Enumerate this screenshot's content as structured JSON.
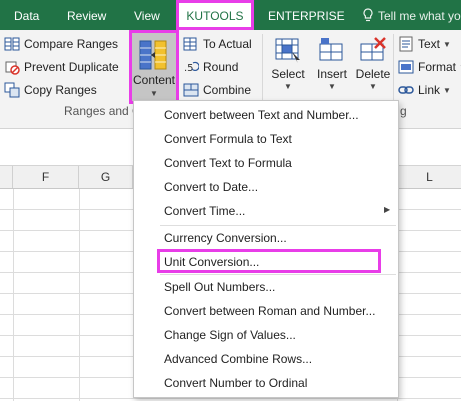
{
  "tabs": {
    "data": "Data",
    "review": "Review",
    "view": "View",
    "kutools": "KUTOOLS",
    "enterprise": "ENTERPRISE",
    "tell_me": "Tell me what yo"
  },
  "ribbon": {
    "compare_ranges": "Compare Ranges",
    "prevent_duplicate": "Prevent Duplicate",
    "copy_ranges": "Copy Ranges",
    "content": "Content",
    "to_actual": "To Actual",
    "round": "Round",
    "combine": "Combine",
    "select": "Select",
    "insert": "Insert",
    "delete": "Delete",
    "text": "Text",
    "format": "Format",
    "link": "Link",
    "group_label_left": "Ranges and C",
    "group_label_right": "g"
  },
  "grid": {
    "columns": [
      "F",
      "G",
      "L"
    ]
  },
  "menu": {
    "items": [
      "Convert between Text and Number...",
      "Convert Formula to Text",
      "Convert Text to Formula",
      "Convert to Date...",
      "Convert Time...",
      "Currency Conversion...",
      "Unit Conversion...",
      "Spell Out Numbers...",
      "Convert between Roman and Number...",
      "Change Sign of Values...",
      "Advanced Combine Rows...",
      "Convert Number to Ordinal"
    ]
  },
  "highlight_color": "#e83de8",
  "brand_color": "#217346"
}
